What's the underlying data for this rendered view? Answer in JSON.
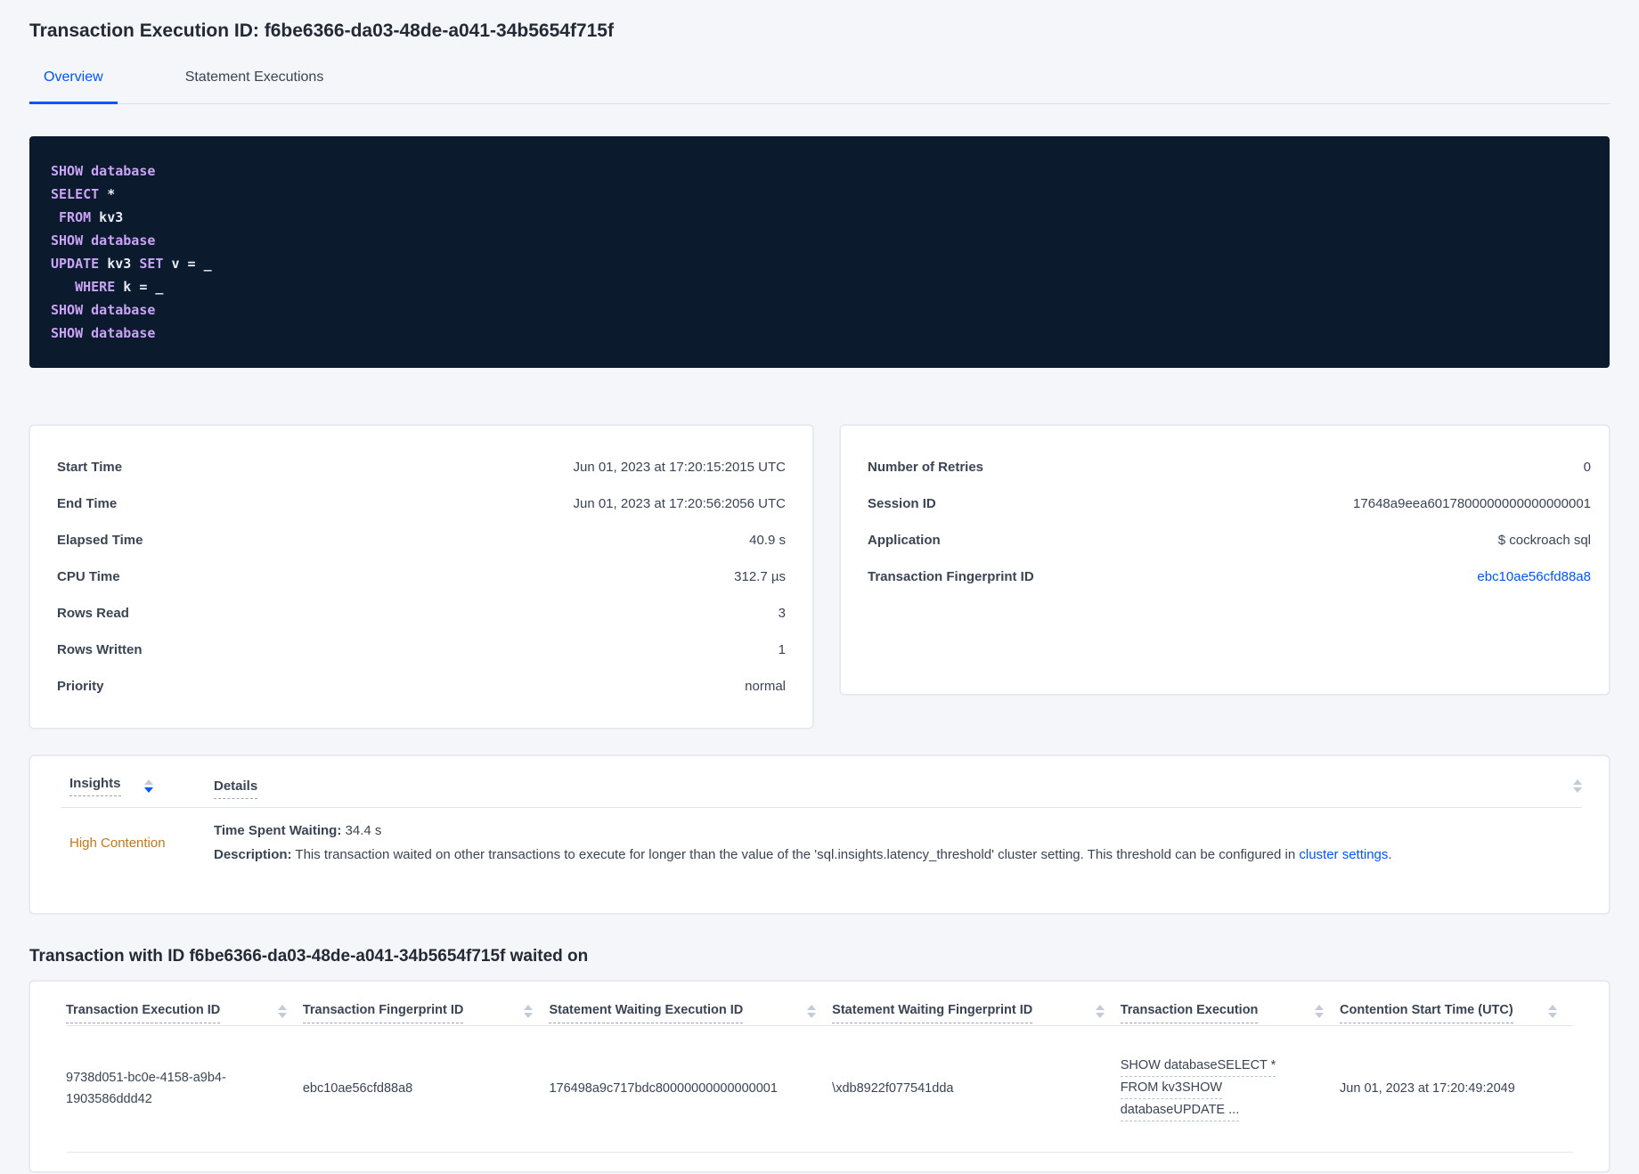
{
  "title": "Transaction Execution ID: f6be6366-da03-48de-a041-34b5654f715f",
  "tabs": {
    "overview": "Overview",
    "statement_executions": "Statement Executions"
  },
  "sql": {
    "lines": [
      [
        {
          "t": "SHOW database"
        }
      ],
      [
        {
          "t": "SELECT"
        },
        {
          "t": " *"
        }
      ],
      [
        {
          "t": " "
        },
        {
          "t": "FROM"
        },
        {
          "t": " kv3"
        }
      ],
      [
        {
          "t": "SHOW database"
        }
      ],
      [
        {
          "t": "UPDATE"
        },
        {
          "t": " kv3 "
        },
        {
          "t": "SET"
        },
        {
          "t": " v = _"
        }
      ],
      [
        {
          "t": "   "
        },
        {
          "t": "WHERE"
        },
        {
          "t": " k = _"
        }
      ],
      [
        {
          "t": "SHOW database"
        }
      ],
      [
        {
          "t": "SHOW database"
        }
      ]
    ]
  },
  "summary_left": {
    "rows": [
      {
        "label": "Start Time",
        "value": "Jun 01, 2023 at 17:20:15:2015 UTC"
      },
      {
        "label": "End Time",
        "value": "Jun 01, 2023 at 17:20:56:2056 UTC"
      },
      {
        "label": "Elapsed Time",
        "value": "40.9 s"
      },
      {
        "label": "CPU Time",
        "value": "312.7 µs"
      },
      {
        "label": "Rows Read",
        "value": "3"
      },
      {
        "label": "Rows Written",
        "value": "1"
      },
      {
        "label": "Priority",
        "value": "normal"
      }
    ]
  },
  "summary_right": {
    "rows": [
      {
        "label": "Number of Retries",
        "value": "0"
      },
      {
        "label": "Session ID",
        "value": "17648a9eea6017800000000000000001"
      },
      {
        "label": "Application",
        "value": "$ cockroach sql"
      },
      {
        "label": "Transaction Fingerprint ID",
        "value": "ebc10ae56cfd88a8"
      }
    ]
  },
  "insights": {
    "header_insights": "Insights",
    "header_details": "Details",
    "insight": "High Contention",
    "waiting_label": "Time Spent Waiting:",
    "waiting_value": " 34.4 s",
    "description_label": "Description:",
    "description_text": " This transaction waited on other transactions to execute for longer than the value of the 'sql.insights.latency_threshold' cluster setting. This threshold can be configured in ",
    "description_link": "cluster settings",
    "description_suffix": "."
  },
  "waited": {
    "heading": "Transaction with ID f6be6366-da03-48de-a041-34b5654f715f waited on",
    "headers": [
      "Transaction Execution ID",
      "Transaction Fingerprint ID",
      "Statement Waiting Execution ID",
      "Statement Waiting Fingerprint ID",
      "Transaction Execution",
      "Contention Start Time (UTC)"
    ],
    "row": {
      "transaction_execution_id": "9738d051-bc0e-4158-a9b4-1903586ddd42",
      "transaction_fingerprint_id": "ebc10ae56cfd88a8",
      "statement_waiting_execution_id": "176498a9c717bdc80000000000000001",
      "statement_waiting_fingerprint_id": "\\xdb8922f077541dda",
      "transaction_execution_lines": [
        "SHOW databaseSELECT *",
        "FROM kv3SHOW",
        "databaseUPDATE ..."
      ],
      "contention_start_time": "Jun 01, 2023 at 17:20:49:2049"
    }
  },
  "colors": {
    "accent_blue": "#0055ff",
    "insight_orange": "#c1771c",
    "code_background": "#0b1a2c",
    "code_keyword": "#c9a4f5",
    "code_text": "#e9edf5",
    "page_background": "#f4f6fa"
  }
}
